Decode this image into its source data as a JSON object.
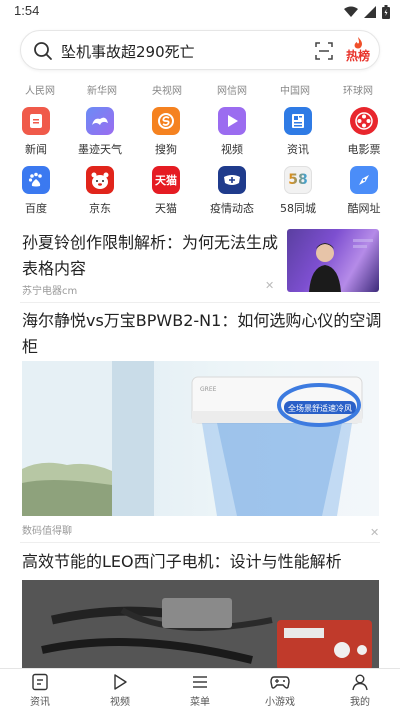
{
  "status_bar": {
    "time": "1:54"
  },
  "search": {
    "query": "坠机事故超290死亡",
    "hot_label": "热榜"
  },
  "sites": [
    "人民网",
    "新华网",
    "央视网",
    "网信网",
    "中国网",
    "环球网"
  ],
  "apps": [
    {
      "label": "新闻",
      "icon": "news-app-icon",
      "color": "#f05a4a"
    },
    {
      "label": "墨迹天气",
      "icon": "weather-app-icon",
      "color": "#5c7cf0"
    },
    {
      "label": "搜狗",
      "icon": "sogou-app-icon",
      "color": "#f58220"
    },
    {
      "label": "视频",
      "icon": "video-app-icon",
      "color": "#9b6cf0"
    },
    {
      "label": "资讯",
      "icon": "info-app-icon",
      "color": "#2f7be5"
    },
    {
      "label": "电影票",
      "icon": "movie-ticket-app-icon",
      "color": "#e8262d"
    },
    {
      "label": "百度",
      "icon": "baidu-app-icon",
      "color": "#3b79f0"
    },
    {
      "label": "京东",
      "icon": "jd-app-icon",
      "color": "#e1251b"
    },
    {
      "label": "天猫",
      "icon": "tmall-app-icon",
      "color": "#e51c23"
    },
    {
      "label": "疫情动态",
      "icon": "epidemic-app-icon",
      "color": "#1f3b8c"
    },
    {
      "label": "58同城",
      "icon": "58tongcheng-app-icon",
      "color": "#f2f2f2"
    },
    {
      "label": "酷网址",
      "icon": "compass-app-icon",
      "color": "#4b8df8"
    }
  ],
  "tile_texts": {
    "tmall": "天猫",
    "n58": "58"
  },
  "news": [
    {
      "title_line1": "孙夏铃创作限制解析：为何无法生成",
      "title_line2": "表格内容",
      "source": "苏宁电器cm"
    },
    {
      "title_line1": "海尔静悦vs万宝BPWB2-N1：如何选购心仪的空调柜",
      "title_line2": "机？",
      "source": "数码值得聊",
      "banner_text": "全场景舒适速冷风"
    },
    {
      "title_line1": "高效节能的LEO西门子电机：设计与性能解析"
    }
  ],
  "bottom_nav": [
    "资讯",
    "视频",
    "菜单",
    "小游戏",
    "我的"
  ]
}
